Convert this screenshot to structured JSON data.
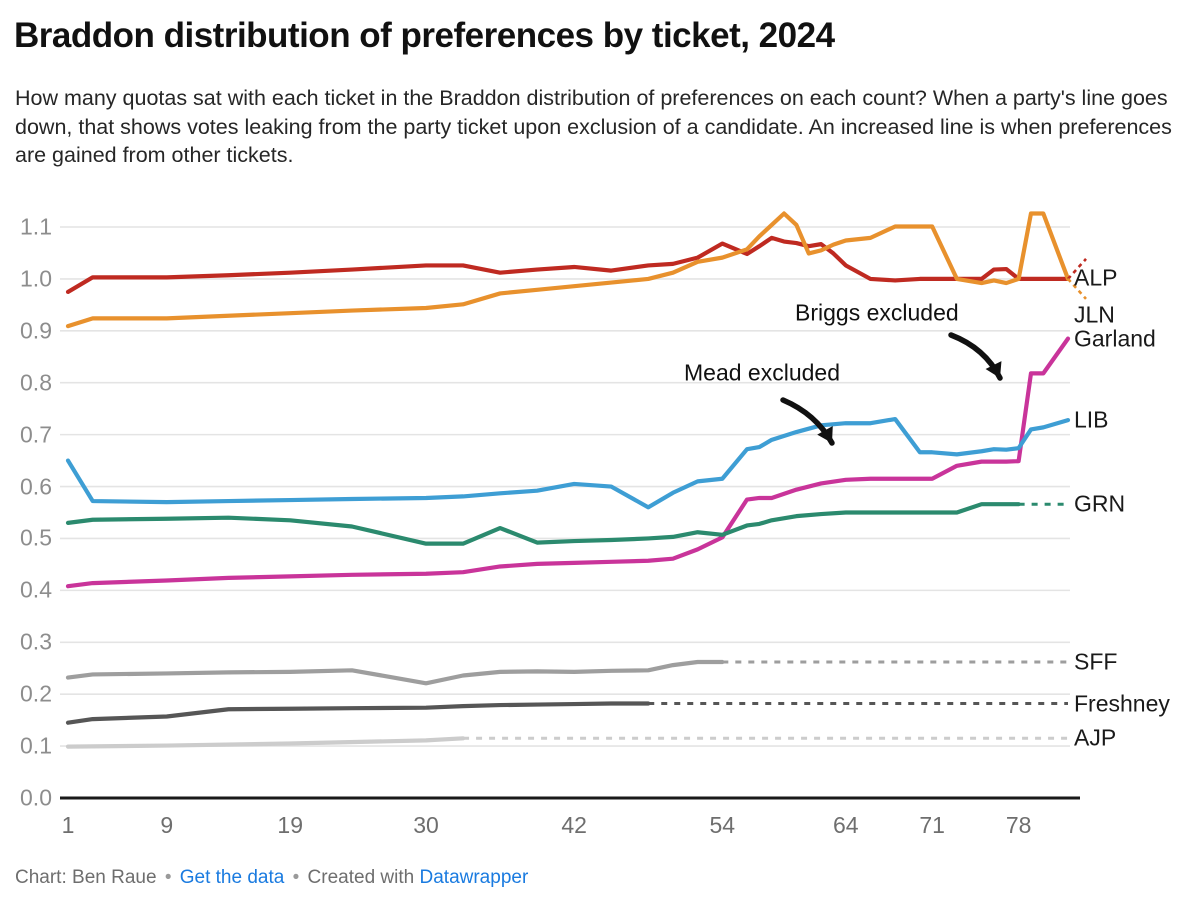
{
  "header": {
    "title": "Braddon distribution of preferences by ticket, 2024",
    "description": "How many quotas sat with each ticket in the Braddon distribution of preferences on each count? When a party's line goes down, that shows votes leaking from the party ticket upon exclusion of a candidate. An increased line is when preferences are gained from other tickets."
  },
  "footer": {
    "credit": "Chart: Ben Raue",
    "data_link": "Get the data",
    "created_with": "Created with",
    "tool_link": "Datawrapper",
    "separator": "•",
    "link_color": "#1a7be0"
  },
  "annotations": [
    {
      "id": "briggs",
      "text": "Briggs excluded"
    },
    {
      "id": "mead",
      "text": "Mead excluded"
    }
  ],
  "chart_data": {
    "type": "line",
    "title": "Braddon distribution of preferences by ticket, 2024",
    "xlabel": "",
    "ylabel": "",
    "xlim": [
      1,
      82
    ],
    "ylim": [
      0.0,
      1.1
    ],
    "grid": true,
    "legend_position": "right-inline-labels",
    "ytick_labels": [
      "1.1",
      "1.0",
      "0.9",
      "0.8",
      "0.7",
      "0.6",
      "0.5",
      "0.4",
      "0.3",
      "0.2",
      "0.1",
      "0.0"
    ],
    "ytick_values": [
      1.1,
      1.0,
      0.9,
      0.8,
      0.7,
      0.6,
      0.5,
      0.4,
      0.3,
      0.2,
      0.1,
      0.0
    ],
    "xtick_labels": [
      "1",
      "9",
      "19",
      "30",
      "42",
      "54",
      "64",
      "71",
      "78"
    ],
    "xtick_values": [
      1,
      9,
      19,
      30,
      42,
      54,
      64,
      71,
      78
    ],
    "series": [
      {
        "name": "ALP",
        "color": "#bf2a21",
        "label_value": 1.0,
        "x": [
          1,
          3,
          9,
          14,
          19,
          24,
          30,
          33,
          36,
          39,
          42,
          45,
          48,
          50,
          52,
          54,
          56,
          57,
          58,
          59,
          60,
          61,
          62,
          63,
          64,
          66,
          68,
          70,
          71,
          73,
          75,
          76,
          77,
          78,
          79,
          80,
          82
        ],
        "values": [
          0.975,
          1.003,
          1.003,
          1.007,
          1.012,
          1.018,
          1.026,
          1.026,
          1.012,
          1.018,
          1.023,
          1.016,
          1.026,
          1.029,
          1.041,
          1.068,
          1.048,
          1.063,
          1.079,
          1.072,
          1.069,
          1.063,
          1.067,
          1.049,
          1.026,
          1.0,
          0.997,
          1.0,
          1.0,
          1.0,
          1.0,
          1.018,
          1.019,
          1.0,
          1.0,
          1.0,
          1.0
        ],
        "dashed_tail": false
      },
      {
        "name": "JLN",
        "color": "#e8912d",
        "label_value": 0.97,
        "x": [
          1,
          3,
          9,
          14,
          19,
          24,
          30,
          33,
          36,
          39,
          42,
          45,
          48,
          50,
          52,
          54,
          56,
          57,
          58,
          59,
          60,
          61,
          62,
          63,
          64,
          66,
          68,
          70,
          71,
          73,
          75,
          76,
          77,
          78,
          79,
          80,
          82
        ],
        "values": [
          0.909,
          0.924,
          0.924,
          0.929,
          0.934,
          0.939,
          0.944,
          0.951,
          0.972,
          0.979,
          0.986,
          0.993,
          1.0,
          1.012,
          1.033,
          1.041,
          1.057,
          1.082,
          1.104,
          1.126,
          1.104,
          1.049,
          1.055,
          1.066,
          1.074,
          1.079,
          1.101,
          1.101,
          1.101,
          1.0,
          0.992,
          0.997,
          0.992,
          1.0,
          1.126,
          1.126,
          1.0
        ],
        "dashed_tail": false
      },
      {
        "name": "Garland",
        "color": "#c9349a",
        "label_value": 0.885,
        "x": [
          1,
          3,
          9,
          14,
          19,
          24,
          30,
          33,
          36,
          39,
          42,
          45,
          48,
          50,
          52,
          54,
          56,
          57,
          58,
          60,
          62,
          64,
          66,
          68,
          70,
          71,
          73,
          75,
          76,
          77,
          78,
          79,
          80,
          82
        ],
        "values": [
          0.408,
          0.414,
          0.419,
          0.424,
          0.427,
          0.43,
          0.432,
          0.435,
          0.446,
          0.451,
          0.453,
          0.455,
          0.457,
          0.461,
          0.479,
          0.502,
          0.575,
          0.578,
          0.578,
          0.594,
          0.606,
          0.613,
          0.615,
          0.615,
          0.615,
          0.615,
          0.64,
          0.648,
          0.648,
          0.648,
          0.649,
          0.818,
          0.818,
          0.885
        ],
        "dashed_tail": false
      },
      {
        "name": "LIB",
        "color": "#3e9ed4",
        "label_value": 0.728,
        "x": [
          1,
          3,
          9,
          14,
          19,
          24,
          30,
          33,
          36,
          39,
          42,
          45,
          48,
          50,
          52,
          54,
          56,
          57,
          58,
          60,
          62,
          64,
          66,
          68,
          70,
          71,
          73,
          75,
          76,
          77,
          78,
          79,
          80,
          82
        ],
        "values": [
          0.65,
          0.572,
          0.57,
          0.572,
          0.574,
          0.576,
          0.578,
          0.581,
          0.587,
          0.592,
          0.605,
          0.6,
          0.56,
          0.588,
          0.61,
          0.615,
          0.672,
          0.676,
          0.69,
          0.705,
          0.718,
          0.722,
          0.722,
          0.73,
          0.666,
          0.666,
          0.662,
          0.668,
          0.672,
          0.671,
          0.674,
          0.71,
          0.714,
          0.728
        ],
        "dashed_tail": false
      },
      {
        "name": "GRN",
        "color": "#2b8a6e",
        "label_value": 0.566,
        "x": [
          1,
          3,
          9,
          14,
          19,
          24,
          30,
          33,
          36,
          39,
          42,
          45,
          48,
          50,
          52,
          54,
          56,
          57,
          58,
          60,
          62,
          64,
          66,
          68,
          70,
          71,
          73,
          75,
          76,
          77,
          78
        ],
        "values": [
          0.53,
          0.536,
          0.538,
          0.54,
          0.535,
          0.523,
          0.49,
          0.49,
          0.52,
          0.492,
          0.495,
          0.497,
          0.5,
          0.503,
          0.512,
          0.507,
          0.525,
          0.528,
          0.535,
          0.543,
          0.547,
          0.55,
          0.55,
          0.55,
          0.55,
          0.55,
          0.55,
          0.566,
          0.566,
          0.566,
          0.566
        ],
        "dashed_tail": true,
        "dashed_to_x": 82
      },
      {
        "name": "SFF",
        "color": "#9e9e9e",
        "label_value": 0.262,
        "x": [
          1,
          3,
          9,
          14,
          19,
          24,
          30,
          33,
          36,
          39,
          42,
          45,
          48,
          50,
          52,
          54
        ],
        "values": [
          0.232,
          0.238,
          0.24,
          0.242,
          0.243,
          0.246,
          0.221,
          0.236,
          0.243,
          0.244,
          0.243,
          0.245,
          0.246,
          0.256,
          0.262,
          0.262
        ],
        "dashed_tail": true,
        "dashed_to_x": 82
      },
      {
        "name": "Freshney",
        "color": "#565656",
        "label_value": 0.182,
        "x": [
          1,
          3,
          9,
          14,
          19,
          24,
          30,
          33,
          36,
          39,
          42,
          45,
          48
        ],
        "values": [
          0.145,
          0.152,
          0.157,
          0.171,
          0.172,
          0.173,
          0.174,
          0.177,
          0.179,
          0.18,
          0.181,
          0.182,
          0.182
        ],
        "dashed_tail": true,
        "dashed_to_x": 82
      },
      {
        "name": "AJP",
        "color": "#cccccc",
        "label_value": 0.115,
        "x": [
          1,
          9,
          19,
          30,
          33
        ],
        "values": [
          0.099,
          0.101,
          0.105,
          0.111,
          0.115
        ],
        "dashed_tail": true,
        "dashed_to_x": 82
      }
    ]
  }
}
